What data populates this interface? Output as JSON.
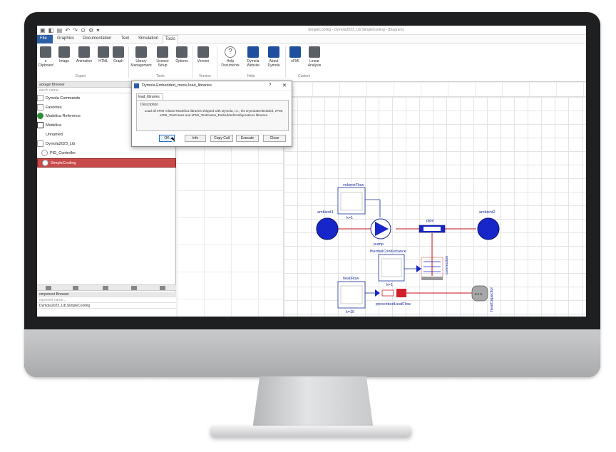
{
  "window": {
    "title": "SimpleCooling - Dymola2023_Lib.SimpleCooling - [Diagram]"
  },
  "menu": {
    "file": "File",
    "items": [
      "Graphics",
      "Documentation",
      "Text",
      "Simulation",
      "Tools"
    ]
  },
  "ribbon": {
    "buttons": [
      {
        "label": "o Clipboard",
        "icon": "clipboard-icon"
      },
      {
        "label": "Image",
        "icon": "image-icon"
      },
      {
        "label": "Animation",
        "icon": "animation-icon"
      },
      {
        "label": "HTML",
        "icon": "html-icon"
      },
      {
        "label": "Graph",
        "icon": "graph-icon"
      },
      {
        "label": "Library Management",
        "icon": "library-icon"
      },
      {
        "label": "License Setup",
        "icon": "license-icon"
      },
      {
        "label": "Options",
        "icon": "gear-icon"
      },
      {
        "label": "Version",
        "icon": "version-icon"
      },
      {
        "label": "Help Documents",
        "icon": "help-icon"
      },
      {
        "label": "Dymola Website",
        "icon": "website-icon"
      },
      {
        "label": "About Dymola",
        "icon": "about-icon"
      },
      {
        "label": "eFMI",
        "icon": "efmi-icon"
      },
      {
        "label": "Linear Analysis",
        "icon": "linear-analysis-icon"
      }
    ],
    "groups": [
      "Export",
      "Tools",
      "Version",
      "Help",
      "Custom"
    ]
  },
  "package_browser": {
    "header": "ackage Browser",
    "search_placeholder": "earch name...",
    "items": [
      {
        "label": "Dymola Commands"
      },
      {
        "label": "Favorites"
      },
      {
        "label": "Modelica Reference"
      },
      {
        "label": "Modelica"
      },
      {
        "label": "Unnamed"
      },
      {
        "label": "Dymola2023_Lib"
      },
      {
        "label": "PID_Controller"
      },
      {
        "label": "SimpleCooling"
      }
    ]
  },
  "component_browser": {
    "header": "omponent Browser",
    "search_placeholder": "mponent name...",
    "path": "Dymola2023_Lib.SimpleCooling"
  },
  "dialog": {
    "title": "Dymola.Embedded_menu.load_libraries",
    "tab": "load_libraries",
    "description_label": "Description",
    "description": "Load all eFMI related Modelica libraries shipped with Dymola, i.e., the DymolaEmbedded, eFMI, eFMI_TestCases and eFMI_TestCases_EmbeddedConfigurations libraries.",
    "buttons": {
      "ok": "OK",
      "info": "Info",
      "copy_call": "Copy Call",
      "execute": "Execute",
      "close": "Close"
    }
  },
  "diagram": {
    "labels": {
      "volumeFlow": "volumeFlow",
      "k1": "k=1",
      "ambient1": "ambient1",
      "ambient2": "ambient2",
      "pipe": "pipe",
      "pump": "pump",
      "thermalConductance": "thermalConductance",
      "k2": "k=1",
      "convection": "convection",
      "heatFlow": "heatFlow",
      "k10": "k=10",
      "prescribedHeatFlow": "prescribedHeatFlow",
      "heatCapacitor": "heatCapacitor",
      "capacitor_temp": "0.1 K"
    },
    "colors": {
      "port_blue": "#1726c9",
      "connection_red": "#c0101c",
      "heat_red": "#d21f2a"
    }
  }
}
